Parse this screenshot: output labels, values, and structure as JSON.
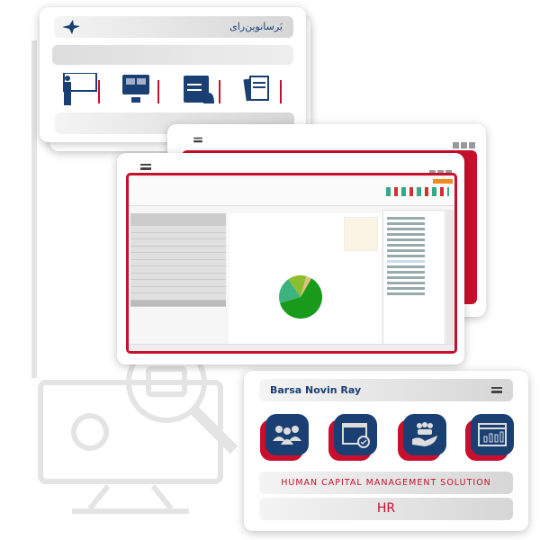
{
  "top_card": {
    "brand_fa": "بَرسانوین‌رای",
    "logo": "bird-logo",
    "icons": [
      "presentation-icon",
      "monitor-dashboard-icon",
      "calendar-alarm-icon",
      "documents-icon"
    ]
  },
  "hr_card": {
    "brand": "Barsa Novin Ray",
    "subtitle": "HUMAN CAPITAL MANAGEMENT SOLUTION",
    "title": "HR",
    "icons": [
      "group-icon",
      "calendar-check-icon",
      "hand-people-icon",
      "dashboard-chart-icon"
    ]
  },
  "colors": {
    "navy": "#1a3f73",
    "red": "#c8102e",
    "gray": "#d6d6d6",
    "pie_green": "#1a9a1a",
    "pie_teal": "#3cb37f",
    "pie_lime": "#8cbf2f",
    "pie_tan": "#e0c080"
  },
  "app_window": {
    "chart_slices_percent": [
      62,
      20,
      14,
      4
    ]
  }
}
